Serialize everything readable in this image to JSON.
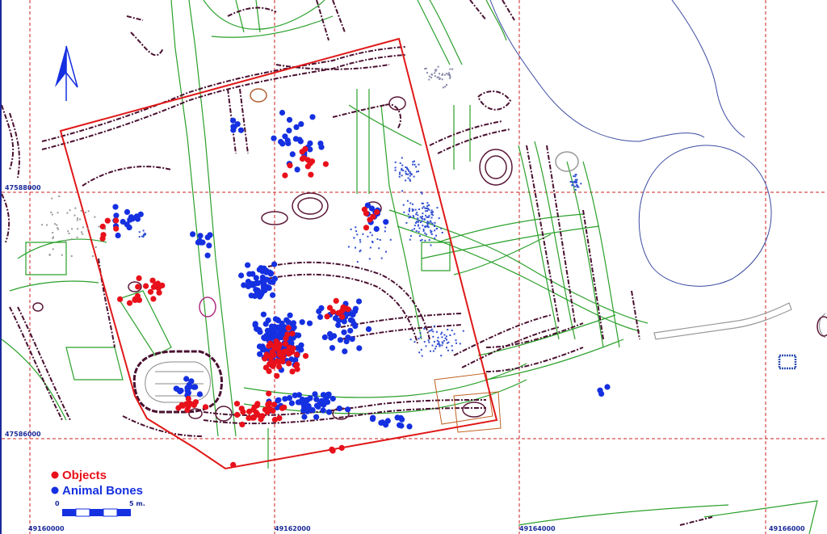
{
  "map": {
    "grid_labels": {
      "northing_upper": "47588000",
      "northing_lower": "47586000",
      "easting_1": "49160000",
      "easting_2": "49162000",
      "easting_3": "49164000",
      "easting_4": "49166000"
    },
    "legend": {
      "objects_label": "Objects",
      "animal_bones_label": "Animal Bones",
      "objects_color": "#e8101a",
      "animal_bones_color": "#1530e0"
    },
    "scale_bar": {
      "start_label": "0",
      "end_label": "5 m."
    },
    "north_arrow_icon": "north-arrow-icon",
    "colors": {
      "grid": "#cc2222",
      "excavation_boundary": "#e01818",
      "features": "#2aa02a",
      "features_alt": "#7a2a40",
      "river_outline": "#3a4aa0",
      "coord_text": "#1a2a9a"
    }
  }
}
